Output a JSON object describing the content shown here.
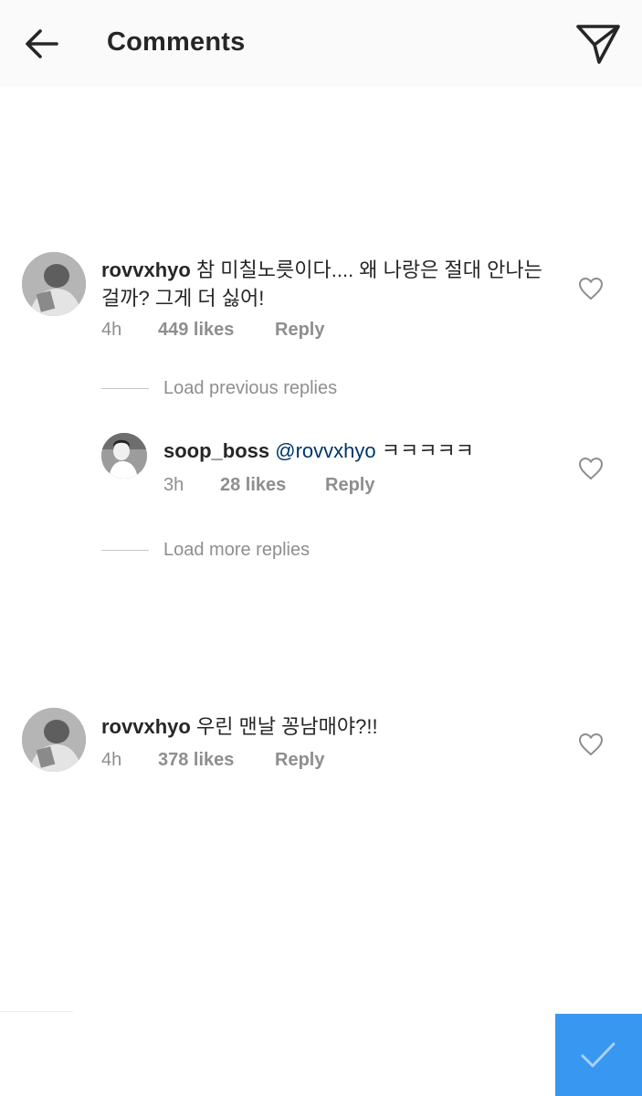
{
  "header": {
    "title": "Comments",
    "back_icon": "arrow-left-icon",
    "send_icon": "paper-plane-icon"
  },
  "comments": [
    {
      "username": "rovvxhyo",
      "text": "참 미칠노릇이다.... 왜 나랑은 절대 안나는걸까?  그게 더 싫어!",
      "time": "4h",
      "likes": "449 likes",
      "reply": "Reply"
    },
    {
      "username": "rovvxhyo",
      "text": "우린 맨날 꽁남매야?!!",
      "time": "4h",
      "likes": "378 likes",
      "reply": "Reply"
    }
  ],
  "load_previous": "Load previous replies",
  "load_more": "Load more replies",
  "reply_comment": {
    "username": "soop_boss",
    "mention": "@rovvxhyo",
    "text": "ㅋㅋㅋㅋㅋ",
    "time": "3h",
    "likes": "28 likes",
    "reply": "Reply"
  },
  "colors": {
    "accent": "#3897f0",
    "mention": "#003569",
    "meta": "#8e8e8e",
    "header_bg": "#fafafa"
  }
}
